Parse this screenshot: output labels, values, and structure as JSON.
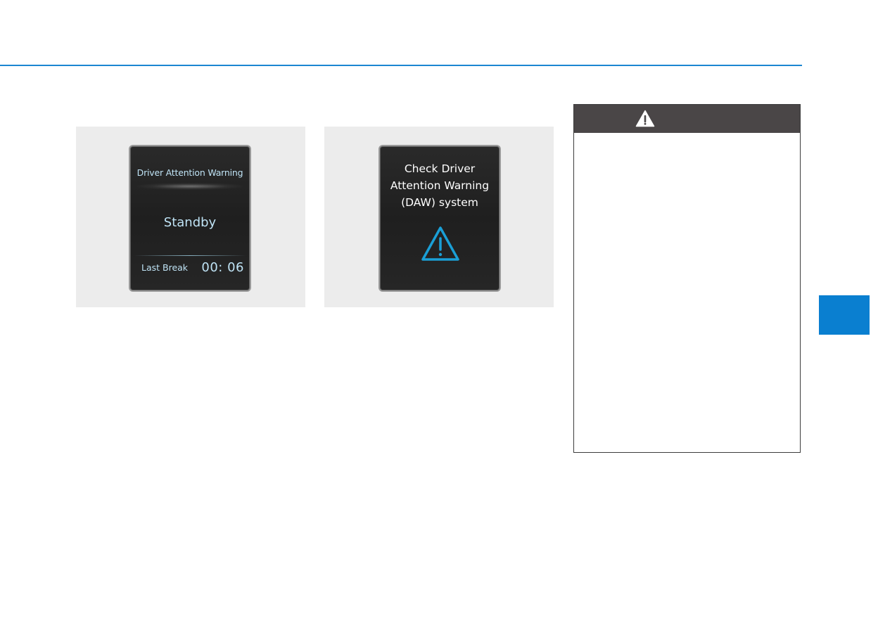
{
  "colors": {
    "accent": "#1c86d1",
    "tab": "#0a7fd0",
    "warning_header": "#4a4647",
    "lcd_text": "#bfe3f5",
    "lcd_icon": "#1a9fd6"
  },
  "figure_standby": {
    "title": "Driver Attention Warning",
    "status": "Standby",
    "last_break_label": "Last Break",
    "last_break_time": "00: 06"
  },
  "figure_check": {
    "line1": "Check Driver",
    "line2": "Attention Warning",
    "line3": "(DAW) system",
    "icon": "warning-triangle-icon"
  },
  "warning_box": {
    "header_icon": "warning-triangle-icon"
  }
}
